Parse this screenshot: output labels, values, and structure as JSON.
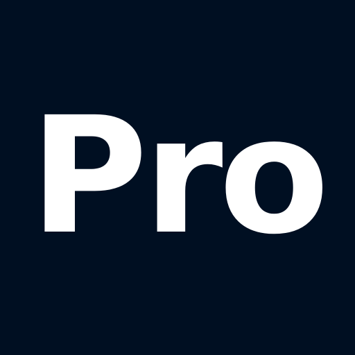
{
  "tile": {
    "text": "Pro",
    "background_color": "#000F22",
    "text_color": "#FFFFFF"
  }
}
